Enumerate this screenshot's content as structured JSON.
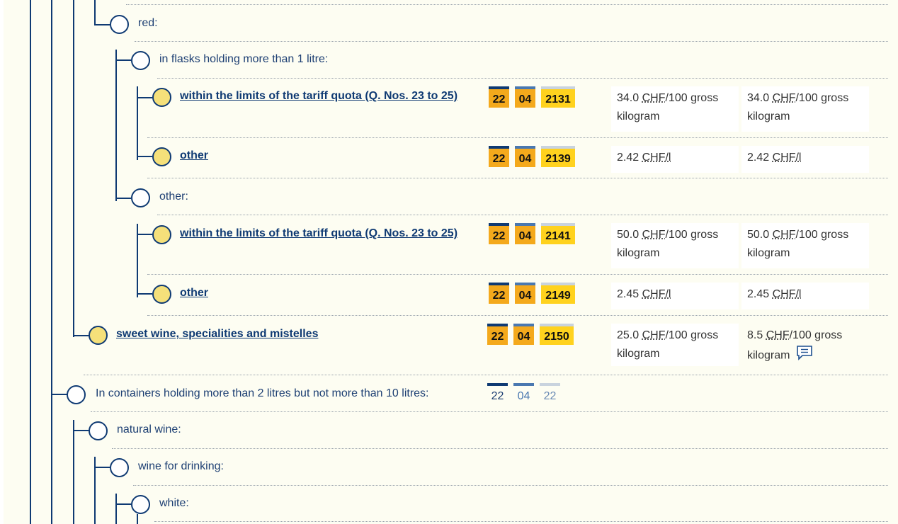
{
  "tree": {
    "red": "red:",
    "flasks": "in flasks holding more than 1 litre:",
    "quota1": "within the limits of the tariff quota (Q. Nos. 23 to 25)",
    "other1": "other",
    "other_group": "other:",
    "quota2": "within the limits of the tariff quota (Q. Nos. 23 to 25)",
    "other2": "other",
    "sweet": "sweet wine, specialities and mistelles",
    "containers": "In containers holding more than 2 litres but not more than 10 litres:",
    "natural": "natural wine:",
    "drinking": "wine for drinking:",
    "white": "white:"
  },
  "codes": {
    "r1": {
      "a": "22",
      "b": "04",
      "c": "2131"
    },
    "r2": {
      "a": "22",
      "b": "04",
      "c": "2139"
    },
    "r3": {
      "a": "22",
      "b": "04",
      "c": "2141"
    },
    "r4": {
      "a": "22",
      "b": "04",
      "c": "2149"
    },
    "r5": {
      "a": "22",
      "b": "04",
      "c": "2150"
    },
    "r6": {
      "a": "22",
      "b": "04",
      "c": "22"
    }
  },
  "duties": {
    "r1": {
      "g_val": "34.0",
      "g_unit": "CHF",
      "g_rest": "/100 gross",
      "g_line2": "kilogram",
      "p_val": "34.0",
      "p_unit": "CHF",
      "p_rest": "/100 gross",
      "p_line2": "kilogram"
    },
    "r2": {
      "g_val": "2.42",
      "g_unit": "CHF/l",
      "p_val": "2.42",
      "p_unit": "CHF/l"
    },
    "r3": {
      "g_val": "50.0",
      "g_unit": "CHF",
      "g_rest": "/100 gross",
      "g_line2": "kilogram",
      "p_val": "50.0",
      "p_unit": "CHF",
      "p_rest": "/100 gross",
      "p_line2": "kilogram"
    },
    "r4": {
      "g_val": "2.45",
      "g_unit": "CHF/l",
      "p_val": "2.45",
      "p_unit": "CHF/l"
    },
    "r5": {
      "g_val": "25.0",
      "g_unit": "CHF",
      "g_rest": "/100 gross",
      "g_line2": "kilogram",
      "p_val": "8.5",
      "p_unit": "CHF",
      "p_rest": "/100 gross",
      "p_line2": "kilogram"
    }
  },
  "icons": {
    "note": "comment-icon"
  },
  "colors": {
    "tree_line": "#0f3a73",
    "leaf": "#f5e07a",
    "code_chapter": "#f4a91c",
    "code_sub": "#ffd21e",
    "background": "#fdfdf2"
  }
}
